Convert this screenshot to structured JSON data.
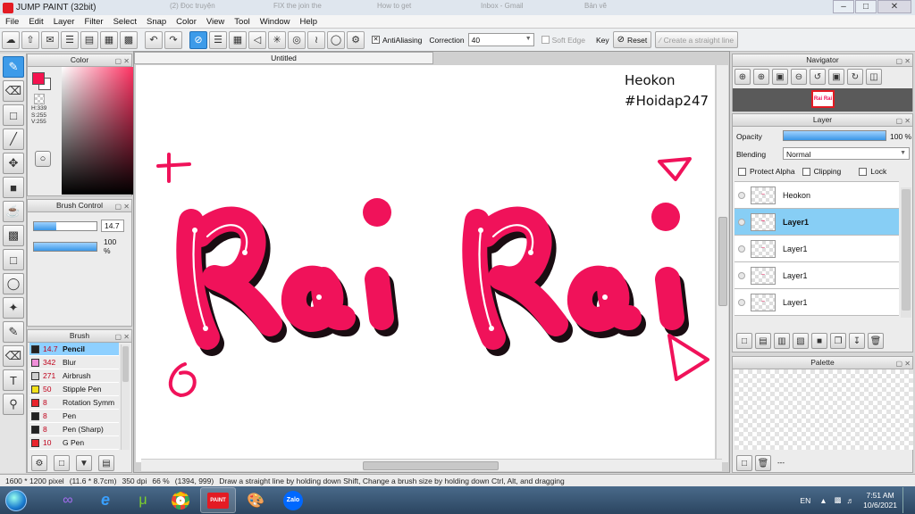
{
  "window": {
    "title": "JUMP PAINT (32bit)",
    "bg_tabs": [
      "(2) Đọc truyện",
      "FIX the join the",
      "How to get",
      "Inbox - Gmail",
      "Bản vẽ"
    ]
  },
  "menu": [
    "File",
    "Edit",
    "Layer",
    "Filter",
    "Select",
    "Snap",
    "Color",
    "View",
    "Tool",
    "Window",
    "Help"
  ],
  "toolbar": {
    "antialiasing_label": "AntiAliasing",
    "correction_label": "Correction",
    "correction_value": "40",
    "soft_edge_label": "Soft Edge",
    "key_label": "Key",
    "reset_label": "Reset",
    "straight_line_label": "Create a straight line"
  },
  "color_panel": {
    "title": "Color",
    "h": "H:339",
    "s": "S:255",
    "v": "V:255",
    "primary_color": "#f5134f",
    "secondary_color": "#ffffff"
  },
  "brush_control": {
    "title": "Brush Control",
    "size": "14.7",
    "opacity": "100 %",
    "size_fill": 0.35,
    "opacity_fill": 1.0
  },
  "brush": {
    "title": "Brush",
    "items": [
      {
        "size": "14.7",
        "name": "Pencil",
        "color": "#222222",
        "selected": true
      },
      {
        "size": "342",
        "name": "Blur",
        "color": "#f08ed8"
      },
      {
        "size": "271",
        "name": "Airbrush",
        "color": "#cfcfcf"
      },
      {
        "size": "50",
        "name": "Stipple Pen",
        "color": "#f2e01a"
      },
      {
        "size": "8",
        "name": "Rotation Symm",
        "color": "#e8242c"
      },
      {
        "size": "8",
        "name": "Pen",
        "color": "#222222"
      },
      {
        "size": "8",
        "name": "Pen (Sharp)",
        "color": "#222222"
      },
      {
        "size": "10",
        "name": "G Pen",
        "color": "#e8242c"
      }
    ]
  },
  "canvas": {
    "tab_title": "Untitled",
    "watermark_line1": "Heokon",
    "watermark_line2": "#Hoidap247",
    "art_text": "Rai Rai",
    "art_color": "#f0125a"
  },
  "navigator": {
    "title": "Navigator"
  },
  "layer_panel": {
    "title": "Layer",
    "opacity_label": "Opacity",
    "opacity_value": "100 %",
    "blending_label": "Blending",
    "blending_value": "Normal",
    "protect_alpha": "Protect Alpha",
    "clipping": "Clipping",
    "lock": "Lock",
    "layers": [
      {
        "name": "Heokon",
        "selected": false
      },
      {
        "name": "Layer1",
        "selected": true
      },
      {
        "name": "Layer1",
        "selected": false
      },
      {
        "name": "Layer1",
        "selected": false
      },
      {
        "name": "Layer1",
        "selected": false
      }
    ]
  },
  "palette": {
    "title": "Palette",
    "footer": "---"
  },
  "status": {
    "size": "1600 * 1200 pixel",
    "cm": "(11.6 * 8.7cm)",
    "dpi": "350 dpi",
    "zoom": "66 %",
    "coords": "(1394, 999)",
    "hint": "Draw a straight line by holding down Shift, Change a brush size by holding down Ctrl, Alt, and dragging"
  },
  "taskbar": {
    "lang": "EN",
    "time": "7:51 AM",
    "date": "10/6/2021",
    "zalo": "Zalo"
  }
}
